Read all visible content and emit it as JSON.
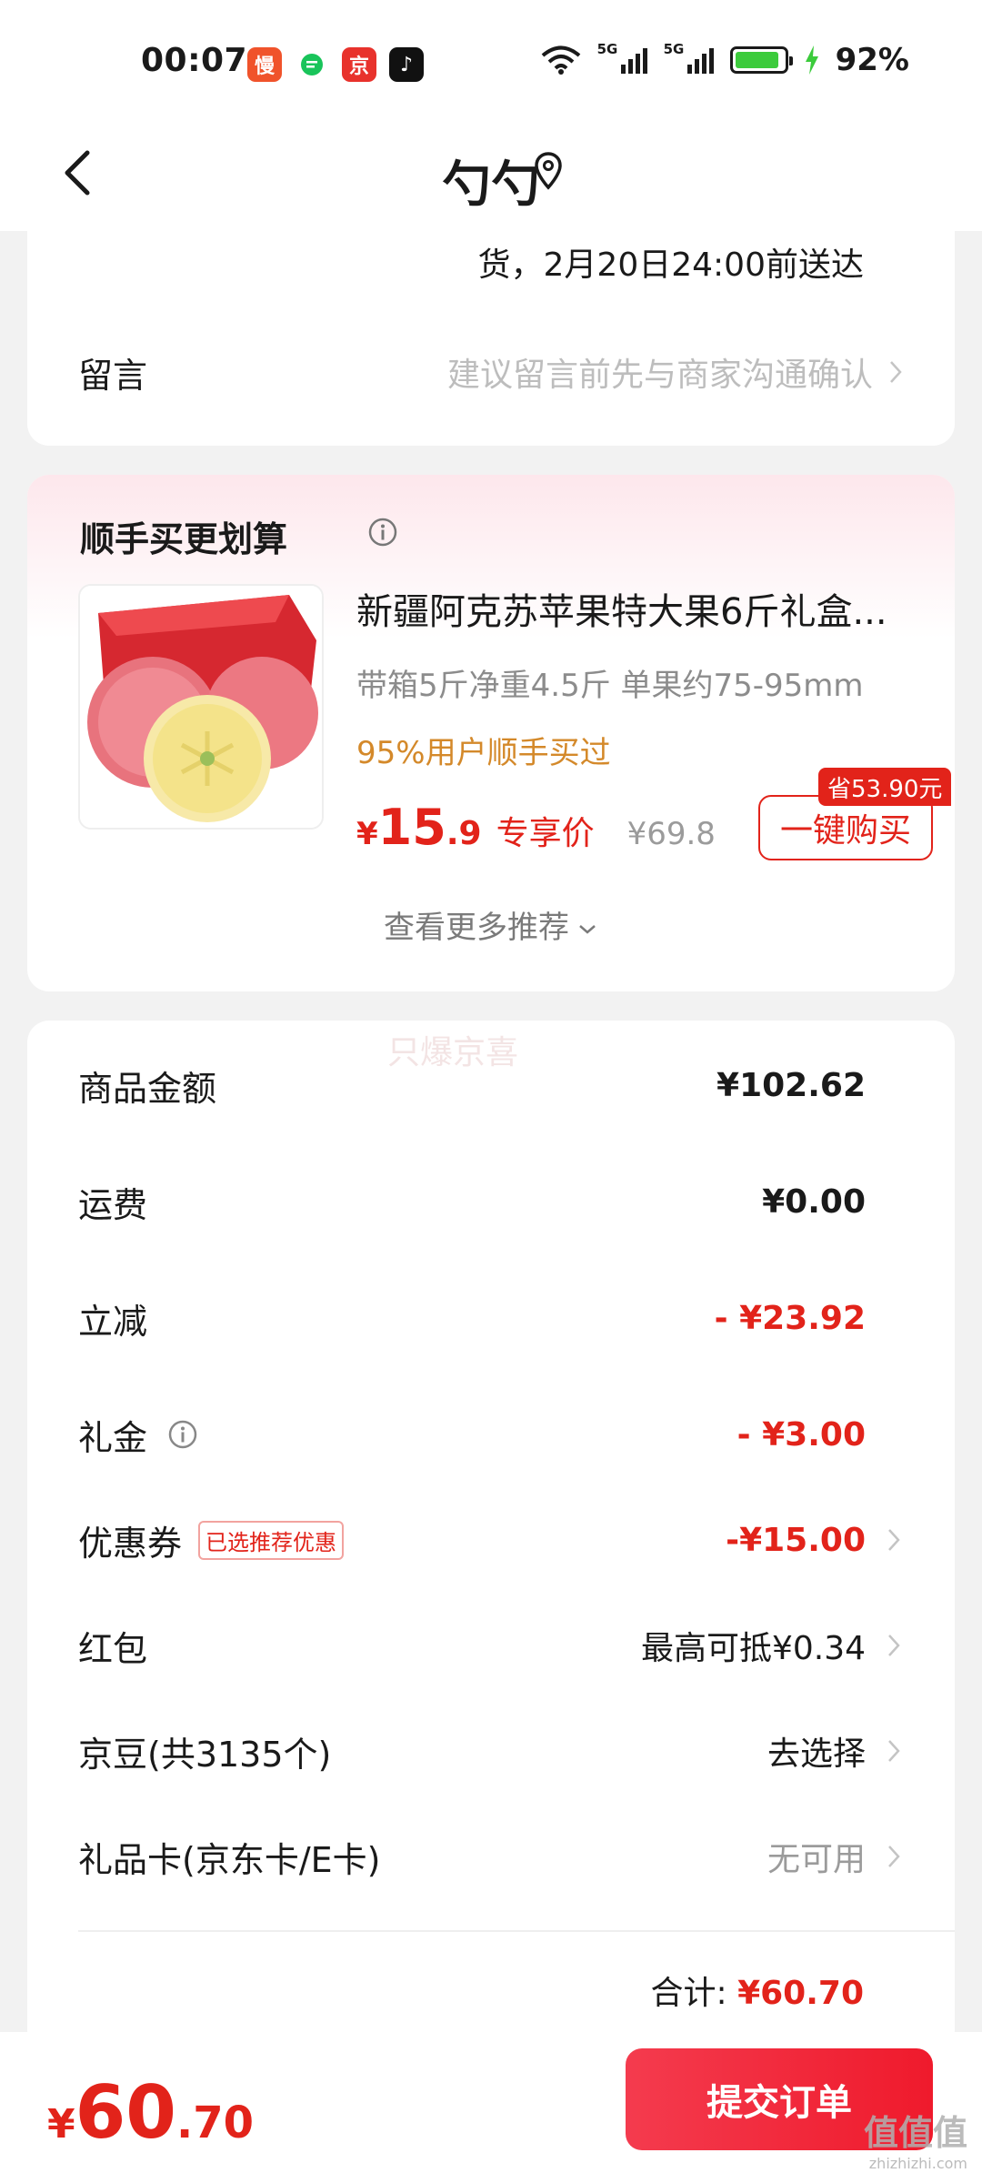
{
  "status_bar": {
    "time": "00:07",
    "battery": "92%",
    "network_1": "5G",
    "network_2": "5G",
    "battery_level": 0.92,
    "app_icons": [
      "manhua-app-icon",
      "message-app-icon",
      "jingdong-app-icon",
      "douyin-app-icon"
    ]
  },
  "nav": {
    "title": "勺勺"
  },
  "delivery": {
    "text": "货，2月20日24:00前送达"
  },
  "message": {
    "label": "留言",
    "hint": "建议留言前先与商家沟通确认"
  },
  "addon": {
    "title": "顺手买更划算",
    "product_name": "新疆阿克苏苹果特大果6斤礼盒...",
    "spec": "带箱5斤净重4.5斤 单果约75-95mm",
    "social": "95%用户顺手买过",
    "price_currency": "¥",
    "price_int": "15",
    "price_dec": ".9",
    "price_tag": "专享价",
    "orig_price": "¥69.8",
    "save_badge": "省53.90元",
    "buy_label": "一键购买",
    "more_label": "查看更多推荐"
  },
  "summary": {
    "watermark": "只爆京喜",
    "rows": [
      {
        "label": "商品金额",
        "value": "¥102.62"
      },
      {
        "label": "运费",
        "value": "¥0.00"
      },
      {
        "label": "立减",
        "value": "- ¥23.92"
      },
      {
        "label": "礼金",
        "value": "- ¥3.00"
      },
      {
        "label": "优惠券",
        "tag": "已选推荐优惠",
        "value": "-¥15.00"
      },
      {
        "label": "红包",
        "value": "最高可抵¥0.34"
      },
      {
        "label": "京豆(共3135个)",
        "value": "去选择"
      },
      {
        "label": "礼品卡(京东卡/E卡)",
        "value": "无可用"
      }
    ],
    "total_label": "合计:",
    "total_value": "¥60.70"
  },
  "bottom": {
    "currency": "¥",
    "price_int": "60",
    "price_dec": ".70",
    "submit_label": "提交订单",
    "logo_text": "值值值",
    "logo_sub": "zhizhizhi.com"
  },
  "colors": {
    "accent": "#e2231a",
    "orange_text": "#d4892a",
    "hint_text": "#bdbdbd"
  }
}
